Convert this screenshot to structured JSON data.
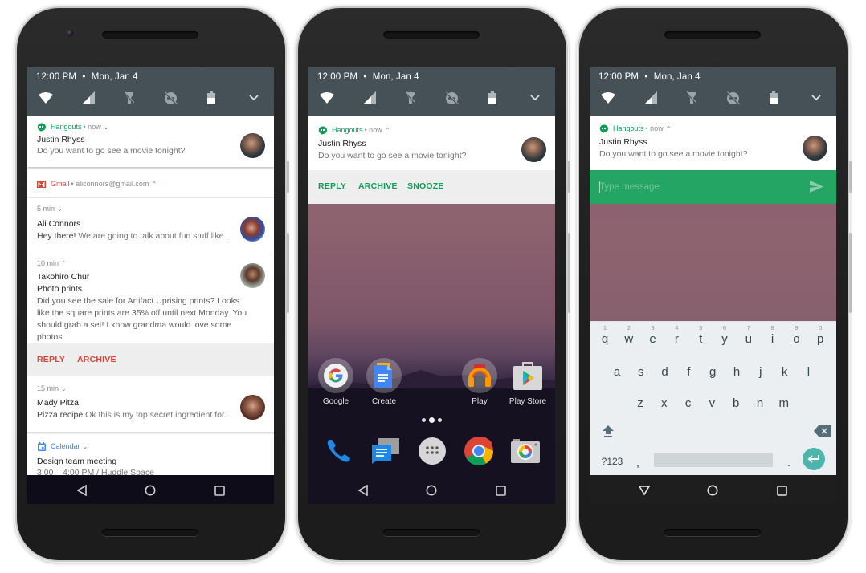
{
  "status_bar": {
    "time": "12:00 PM",
    "separator": "•",
    "date": "Mon, Jan 4"
  },
  "quick_settings": {
    "icons": [
      "wifi-icon",
      "signal-icon",
      "flashlight-off-icon",
      "do-not-disturb-off-icon",
      "battery-icon",
      "expand-chevron-icon"
    ]
  },
  "colors": {
    "hangouts_green": "#0f9d58",
    "gmail_red": "#db4437",
    "calendar_blue": "#4285f4",
    "reply_bar_green": "#25a564",
    "header_slate": "#455157",
    "enter_key_teal": "#4db6ac"
  },
  "phone1": {
    "hangouts": {
      "app": "Hangouts",
      "meta": "• now",
      "sender": "Justin Rhyss",
      "message": "Do you want to go see a movie tonight?"
    },
    "gmail": {
      "app": "Gmail",
      "meta": "• aliconnors@gmail.com",
      "messages": [
        {
          "time": "5 min",
          "sender": "Ali Connors",
          "subject": "Hey there!",
          "preview": "We are going to talk about fun stuff like..."
        },
        {
          "time": "10 min",
          "sender": "Takohiro Chur",
          "subject": "Photo prints",
          "preview": "Did you see the sale for Artifact Uprising prints? Looks like the square prints are 35% off until next Monday. You should grab a set! I know grandma would love some photos."
        },
        {
          "time": "15 min",
          "sender": "Mady Pitza",
          "subject": "Pizza recipe",
          "preview": "Ok this is my top secret ingredient for..."
        }
      ],
      "actions": [
        "REPLY",
        "ARCHIVE"
      ]
    },
    "calendar": {
      "app": "Calendar",
      "event": "Design team meeting",
      "detail": "3:00 – 4:00 PM / Huddle Space"
    }
  },
  "phone2": {
    "hangouts": {
      "app": "Hangouts",
      "meta": "• now",
      "sender": "Justin Rhyss",
      "message": "Do you want to go see a movie tonight?",
      "actions": [
        "REPLY",
        "ARCHIVE",
        "SNOOZE"
      ]
    },
    "home_apps": [
      {
        "label": "Google",
        "icon": "google-folder-icon"
      },
      {
        "label": "Create",
        "icon": "create-folder-icon"
      },
      {
        "label": "Play",
        "icon": "play-folder-icon"
      },
      {
        "label": "Play Store",
        "icon": "play-store-icon"
      }
    ],
    "dock": [
      "phone-icon",
      "messenger-icon",
      "app-drawer-icon",
      "chrome-icon",
      "camera-icon"
    ]
  },
  "phone3": {
    "hangouts": {
      "app": "Hangouts",
      "meta": "• now",
      "sender": "Justin Rhyss",
      "message": "Do you want to go see a movie tonight?"
    },
    "reply": {
      "placeholder": "Type message",
      "value": ""
    },
    "keyboard": {
      "row1": [
        "q",
        "w",
        "e",
        "r",
        "t",
        "y",
        "u",
        "i",
        "o",
        "p"
      ],
      "row1_hints": [
        "1",
        "2",
        "3",
        "4",
        "5",
        "6",
        "7",
        "8",
        "9",
        "0"
      ],
      "row2": [
        "a",
        "s",
        "d",
        "f",
        "g",
        "h",
        "j",
        "k",
        "l"
      ],
      "row3": [
        "z",
        "x",
        "c",
        "v",
        "b",
        "n",
        "m"
      ],
      "symbols_key": "?123",
      "comma": ",",
      "period": "."
    }
  }
}
